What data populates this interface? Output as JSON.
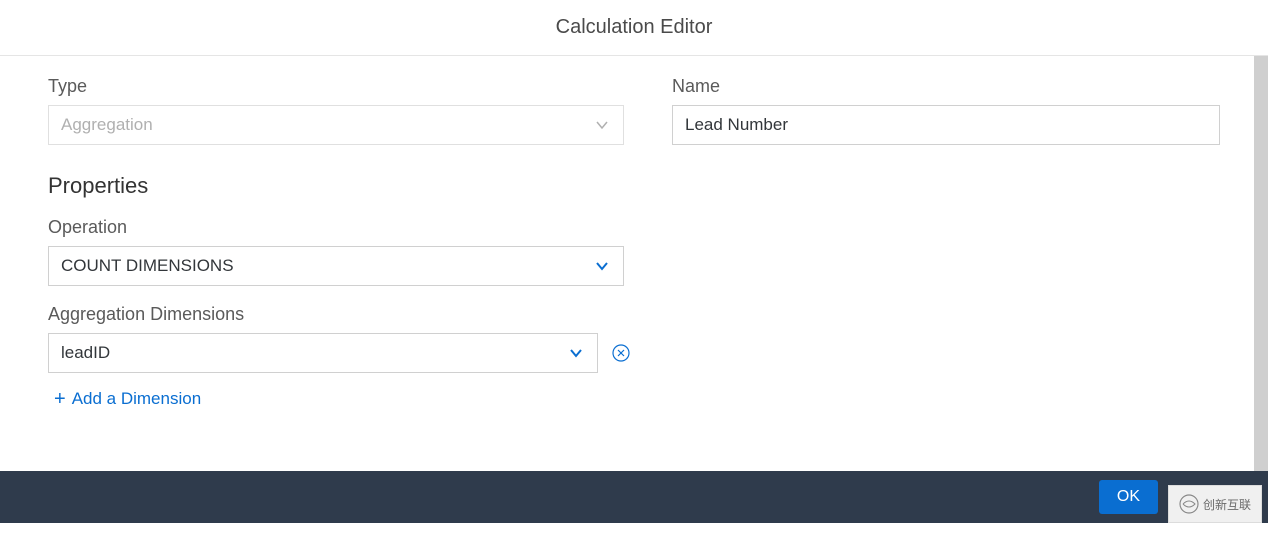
{
  "header": {
    "title": "Calculation Editor"
  },
  "fields": {
    "type": {
      "label": "Type",
      "value": "Aggregation"
    },
    "name": {
      "label": "Name",
      "value": "Lead Number"
    }
  },
  "properties": {
    "title": "Properties",
    "operation": {
      "label": "Operation",
      "value": "COUNT DIMENSIONS"
    },
    "agg_dimensions": {
      "label": "Aggregation Dimensions",
      "items": [
        {
          "value": "leadID"
        }
      ],
      "add_label": "Add a Dimension"
    }
  },
  "footer": {
    "ok": "OK"
  },
  "brand": {
    "text": "创新互联"
  },
  "colors": {
    "accent": "#0a6ed1",
    "footer": "#2f3b4c"
  }
}
